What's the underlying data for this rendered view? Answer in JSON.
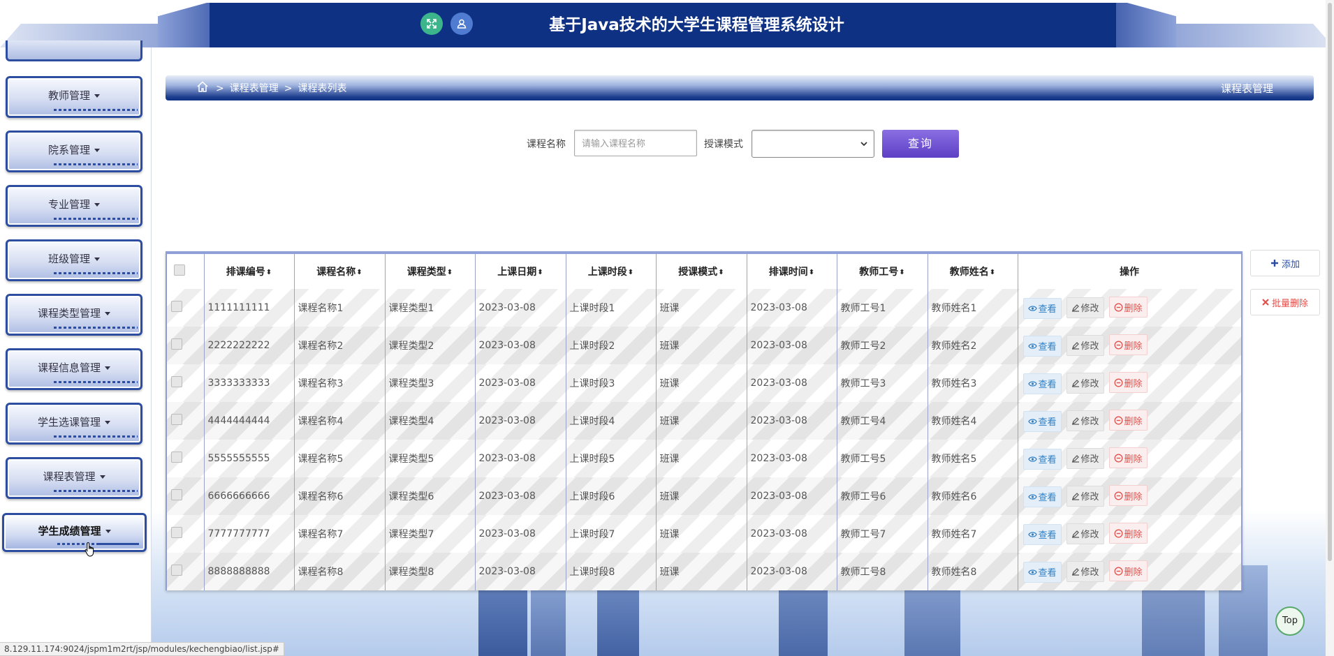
{
  "header": {
    "title": "基于Java技术的大学生课程管理系统设计"
  },
  "sidebar": {
    "items": [
      {
        "label": "教师管理"
      },
      {
        "label": "院系管理"
      },
      {
        "label": "专业管理"
      },
      {
        "label": "班级管理"
      },
      {
        "label": "课程类型管理"
      },
      {
        "label": "课程信息管理"
      },
      {
        "label": "学生选课管理"
      },
      {
        "label": "课程表管理"
      },
      {
        "label": "学生成绩管理",
        "active": true
      }
    ]
  },
  "breadcrumb": {
    "sep": ">",
    "level1": "课程表管理",
    "level2": "课程表列表",
    "right_title": "课程表管理"
  },
  "search": {
    "name_label": "课程名称",
    "name_placeholder": "请输入课程名称",
    "mode_label": "授课模式",
    "mode_value": "",
    "button": "查询"
  },
  "table": {
    "columns": [
      "排课编号",
      "课程名称",
      "课程类型",
      "上课日期",
      "上课时段",
      "授课模式",
      "排课时间",
      "教师工号",
      "教师姓名",
      "操作"
    ],
    "rows": [
      [
        "1111111111",
        "课程名称1",
        "课程类型1",
        "2023-03-08",
        "上课时段1",
        "班课",
        "2023-03-08",
        "教师工号1",
        "教师姓名1"
      ],
      [
        "2222222222",
        "课程名称2",
        "课程类型2",
        "2023-03-08",
        "上课时段2",
        "班课",
        "2023-03-08",
        "教师工号2",
        "教师姓名2"
      ],
      [
        "3333333333",
        "课程名称3",
        "课程类型3",
        "2023-03-08",
        "上课时段3",
        "班课",
        "2023-03-08",
        "教师工号3",
        "教师姓名3"
      ],
      [
        "4444444444",
        "课程名称4",
        "课程类型4",
        "2023-03-08",
        "上课时段4",
        "班课",
        "2023-03-08",
        "教师工号4",
        "教师姓名4"
      ],
      [
        "5555555555",
        "课程名称5",
        "课程类型5",
        "2023-03-08",
        "上课时段5",
        "班课",
        "2023-03-08",
        "教师工号5",
        "教师姓名5"
      ],
      [
        "6666666666",
        "课程名称6",
        "课程类型6",
        "2023-03-08",
        "上课时段6",
        "班课",
        "2023-03-08",
        "教师工号6",
        "教师姓名6"
      ],
      [
        "7777777777",
        "课程名称7",
        "课程类型7",
        "2023-03-08",
        "上课时段7",
        "班课",
        "2023-03-08",
        "教师工号7",
        "教师姓名7"
      ],
      [
        "8888888888",
        "课程名称8",
        "课程类型8",
        "2023-03-08",
        "上课时段8",
        "班课",
        "2023-03-08",
        "教师工号8",
        "教师姓名8"
      ]
    ],
    "actions": {
      "view": "查看",
      "edit": "修改",
      "delete": "删除"
    }
  },
  "side_actions": {
    "add": "添加",
    "batch_delete": "批量删除"
  },
  "top_button": "Top",
  "status_bar": "8.129.11.174:9024/jspm1m2rt/jsp/modules/kechengbiao/list.jsp#",
  "colors": {
    "header": "#0e3183",
    "sidebar_border": "#2d4ea0",
    "query_button": "#6a4fd1",
    "view": "#2d7fc6",
    "delete": "#e2504c"
  },
  "icons": {
    "fullscreen": "fullscreen-icon",
    "user": "user-icon",
    "home": "home-icon",
    "sort": "sort-icon",
    "plus": "plus-icon",
    "close": "close-icon"
  }
}
